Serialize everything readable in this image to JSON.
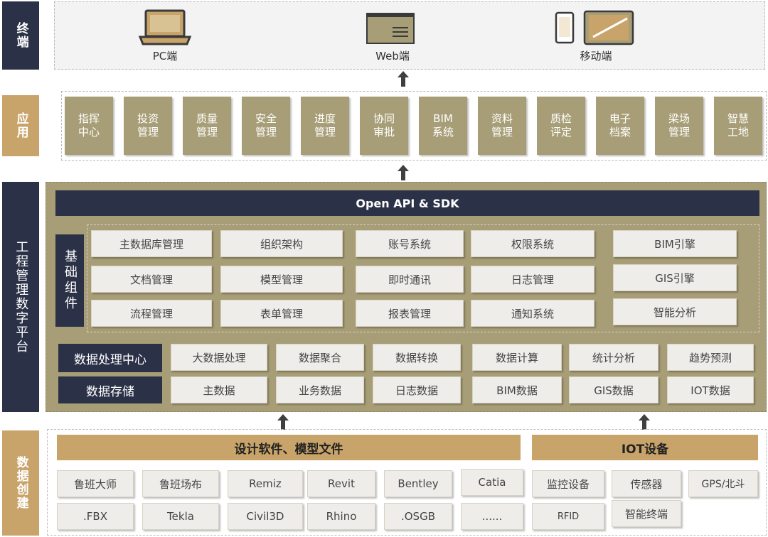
{
  "layers": {
    "terminal": "终端",
    "application": "应用",
    "platform": "工程管理数字平台",
    "data_creation": "数据创建"
  },
  "terminals": [
    {
      "label": "PC端",
      "icon": "laptop-icon"
    },
    {
      "label": "Web端",
      "icon": "web-window-icon"
    },
    {
      "label": "移动端",
      "icon": "mobile-tablet-icon"
    }
  ],
  "apps": [
    "指挥\n中心",
    "投资\n管理",
    "质量\n管理",
    "安全\n管理",
    "进度\n管理",
    "协同\n审批",
    "BIM\n系统",
    "资料\n管理",
    "质检\n评定",
    "电子\n档案",
    "梁场\n管理",
    "智慧\n工地"
  ],
  "platform": {
    "api_bar": "Open API & SDK",
    "base_label": "基础组件",
    "base_components": [
      [
        "主数据库管理",
        "组织架构",
        "账号系统",
        "权限系统",
        "BIM引擎"
      ],
      [
        "文档管理",
        "模型管理",
        "即时通讯",
        "日志管理",
        "GIS引擎"
      ],
      [
        "流程管理",
        "表单管理",
        "报表管理",
        "通知系统",
        "智能分析"
      ]
    ],
    "processing_label": "数据处理中心",
    "processing": [
      "大数据处理",
      "数据聚合",
      "数据转换",
      "数据计算",
      "统计分析",
      "趋势预测"
    ],
    "storage_label": "数据存储",
    "storage": [
      "主数据",
      "业务数据",
      "日志数据",
      "BIM数据",
      "GIS数据",
      "IOT数据"
    ]
  },
  "data_creation": {
    "software_header": "设计软件、模型文件",
    "software_row1": [
      "鲁班大师",
      "鲁班场布",
      "Remiz",
      "Revit",
      "Bentley",
      "Catia"
    ],
    "software_row2": [
      ".FBX",
      "Tekla",
      "Civil3D",
      "Rhino",
      ".OSGB",
      "......"
    ],
    "iot_header": "IOT设备",
    "iot_row1": [
      "监控设备",
      "传感器",
      "GPS/北斗"
    ],
    "iot_row2": [
      "RFID",
      "智能终端"
    ]
  },
  "colors": {
    "navy": "#2b3147",
    "tan": "#c8a46a",
    "olive": "#a79d76",
    "light_tile": "#efedea"
  }
}
